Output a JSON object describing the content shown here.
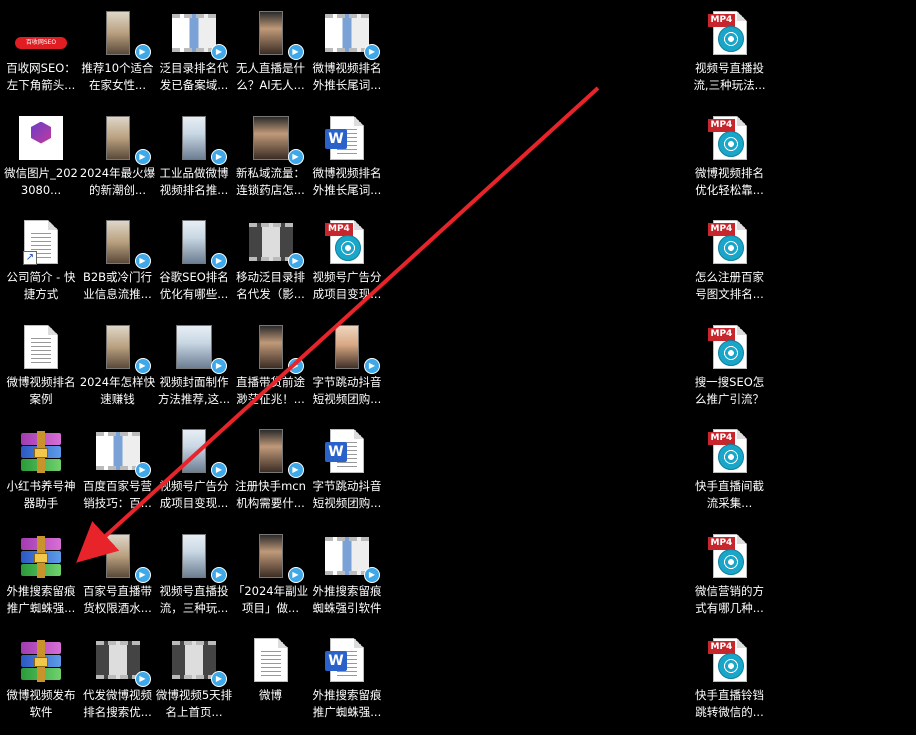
{
  "desktop": {
    "icons": [
      {
        "label": "百收网SEO：左下角箭头...",
        "type": "redpill",
        "col": 0,
        "row": 0
      },
      {
        "label": "推荐10个适合在家女性...",
        "type": "portrait",
        "col": 1,
        "row": 0
      },
      {
        "label": "泛目录排名代发已备案域...",
        "type": "landscape",
        "col": 2,
        "row": 0
      },
      {
        "label": "无人直播是什么？AI无人...",
        "type": "portrait",
        "col": 3,
        "row": 0
      },
      {
        "label": "微博视频排名外推长尾词...",
        "type": "landscape",
        "col": 4,
        "row": 0
      },
      {
        "label": "微信图片_2023080...",
        "type": "applogo",
        "col": 0,
        "row": 1
      },
      {
        "label": "2024年最火爆的新潮创...",
        "type": "portrait",
        "col": 1,
        "row": 1
      },
      {
        "label": "工业品做微博视频排名推...",
        "type": "portrait",
        "col": 2,
        "row": 1
      },
      {
        "label": "新私域流量：连锁药店怎...",
        "type": "portrait-wide",
        "col": 3,
        "row": 1
      },
      {
        "label": "微博视频排名外推长尾词...",
        "type": "word",
        "col": 4,
        "row": 1
      },
      {
        "label": "公司简介 - 快捷方式",
        "type": "shortcut",
        "col": 0,
        "row": 2
      },
      {
        "label": "B2B或冷门行业信息流推...",
        "type": "portrait",
        "col": 1,
        "row": 2
      },
      {
        "label": "谷歌SEO排名优化有哪些...",
        "type": "portrait",
        "col": 2,
        "row": 2
      },
      {
        "label": "移动泛目录排名代发（影...",
        "type": "landscape-dark",
        "col": 3,
        "row": 2
      },
      {
        "label": "视频号广告分成项目变现...",
        "type": "mp4",
        "col": 4,
        "row": 2
      },
      {
        "label": "微博视频排名案例",
        "type": "textfile",
        "col": 0,
        "row": 3
      },
      {
        "label": "2024年怎样快速赚钱",
        "type": "portrait",
        "col": 1,
        "row": 3
      },
      {
        "label": "视频封面制作方法推荐,这...",
        "type": "portrait-wide",
        "col": 2,
        "row": 3
      },
      {
        "label": "直播带货前途渺茫征兆！...",
        "type": "portrait",
        "col": 3,
        "row": 3
      },
      {
        "label": "字节跳动抖音短视频团购...",
        "type": "portrait",
        "col": 4,
        "row": 3
      },
      {
        "label": "小红书养号神器助手",
        "type": "rar",
        "col": 0,
        "row": 4
      },
      {
        "label": "百度百家号营销技巧：百...",
        "type": "landscape",
        "col": 1,
        "row": 4
      },
      {
        "label": "视频号广告分成项目变现...",
        "type": "portrait",
        "col": 2,
        "row": 4
      },
      {
        "label": "注册快手mcn机构需要什...",
        "type": "portrait",
        "col": 3,
        "row": 4
      },
      {
        "label": "字节跳动抖音短视频团购...",
        "type": "word",
        "col": 4,
        "row": 4
      },
      {
        "label": "外推搜索留痕推广蜘蛛强...",
        "type": "rar",
        "col": 0,
        "row": 5
      },
      {
        "label": "百家号直播带货权限酒水...",
        "type": "portrait",
        "col": 1,
        "row": 5
      },
      {
        "label": "视频号直播投流，三种玩...",
        "type": "portrait",
        "col": 2,
        "row": 5
      },
      {
        "label": "「2024年副业项目」做...",
        "type": "portrait",
        "col": 3,
        "row": 5
      },
      {
        "label": "外推搜索留痕蜘蛛强引软件",
        "type": "landscape",
        "col": 4,
        "row": 5
      },
      {
        "label": "微博视频发布软件",
        "type": "rar",
        "col": 0,
        "row": 6
      },
      {
        "label": "代发微博视频排名搜索优...",
        "type": "landscape-dark",
        "col": 1,
        "row": 6
      },
      {
        "label": "微博视频5天排名上首页...",
        "type": "landscape-dark",
        "col": 2,
        "row": 6
      },
      {
        "label": "微博",
        "type": "textfile",
        "col": 3,
        "row": 6
      },
      {
        "label": "外推搜索留痕推广蜘蛛强...",
        "type": "word",
        "col": 4,
        "row": 6
      },
      {
        "label": "视频号直播投流,三种玩法...",
        "type": "mp4",
        "col": 9,
        "row": 0
      },
      {
        "label": "微博视频排名优化轻松靠...",
        "type": "mp4",
        "col": 9,
        "row": 1
      },
      {
        "label": "怎么注册百家号图文排名...",
        "type": "mp4",
        "col": 9,
        "row": 2
      },
      {
        "label": "搜一搜SEO怎么推广引流？",
        "type": "mp4",
        "col": 9,
        "row": 3
      },
      {
        "label": "快手直播间截流采集...",
        "type": "mp4",
        "col": 9,
        "row": 4
      },
      {
        "label": "微信营销的方式有哪几种...",
        "type": "mp4",
        "col": 9,
        "row": 5
      },
      {
        "label": "快手直播铃铛跳转微信的...",
        "type": "mp4",
        "col": 9,
        "row": 6
      }
    ]
  },
  "texts": {
    "mp4_tag": "MP4",
    "word_letter": "W",
    "redpill_text": "百收网SEO"
  },
  "colors": {
    "background": "#000000",
    "arrow": "#e8232a",
    "label": "#ffffff"
  }
}
